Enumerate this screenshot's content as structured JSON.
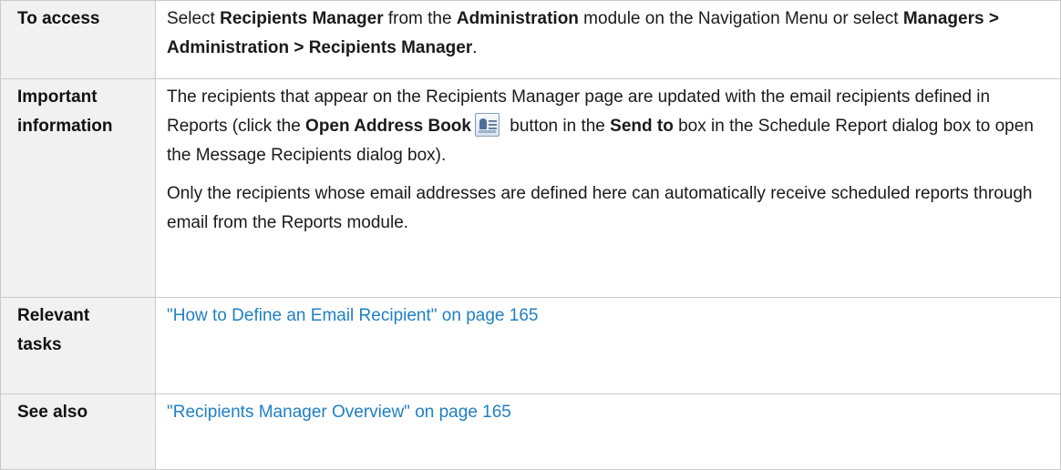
{
  "rows": {
    "access": {
      "header": "To access",
      "t1": "Select ",
      "b1": "Recipients Manager",
      "t2": " from the ",
      "b2": "Administration",
      "t3": " module on the Navigation Menu or select ",
      "b3": "Managers > Administration > Recipients Manager",
      "t4": "."
    },
    "important": {
      "header_line1": "Important",
      "header_line2": "information",
      "p1_t1": "The recipients that appear on the Recipients Manager page are updated with the email recipients defined in Reports (click the ",
      "p1_b1": "Open Address Book",
      "p1_icon": "address-book-icon",
      "p1_t2": " button in the ",
      "p1_b2": "Send to",
      "p1_t3": " box in the Schedule Report dialog box to open the Message Recipients dialog box).",
      "p2": "Only the recipients whose email addresses are defined here can automatically receive scheduled reports through email from the Reports module."
    },
    "tasks": {
      "header_line1": "Relevant",
      "header_line2": "tasks",
      "link": "\"How to Define an Email Recipient\" on page 165"
    },
    "see_also": {
      "header": "See also",
      "link": "\"Recipients Manager Overview\" on page 165"
    }
  },
  "colors": {
    "link": "#1f7fc4",
    "header_bg": "#f1f1f1",
    "border": "#c9c9c9"
  }
}
